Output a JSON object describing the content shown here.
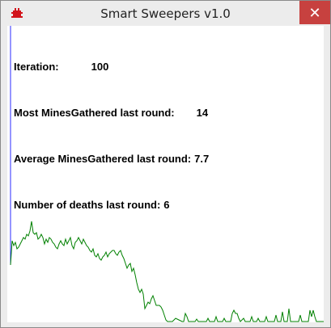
{
  "window": {
    "title": "Smart Sweepers v1.0",
    "close_glyph": "✕",
    "icon": "minesweeper-app-icon"
  },
  "stats": {
    "iteration_label": "Iteration:",
    "iteration_value": "100",
    "most_label": "Most MinesGathered last round:",
    "most_value": "14",
    "average_label": "Average MinesGathered last round:",
    "average_value": "7.7",
    "deaths_label": "Number of deaths last round:",
    "deaths_value": "6"
  },
  "colors": {
    "best_line": "#008000",
    "average_line": "#2a2aff",
    "close_button": "#c7413f"
  }
}
